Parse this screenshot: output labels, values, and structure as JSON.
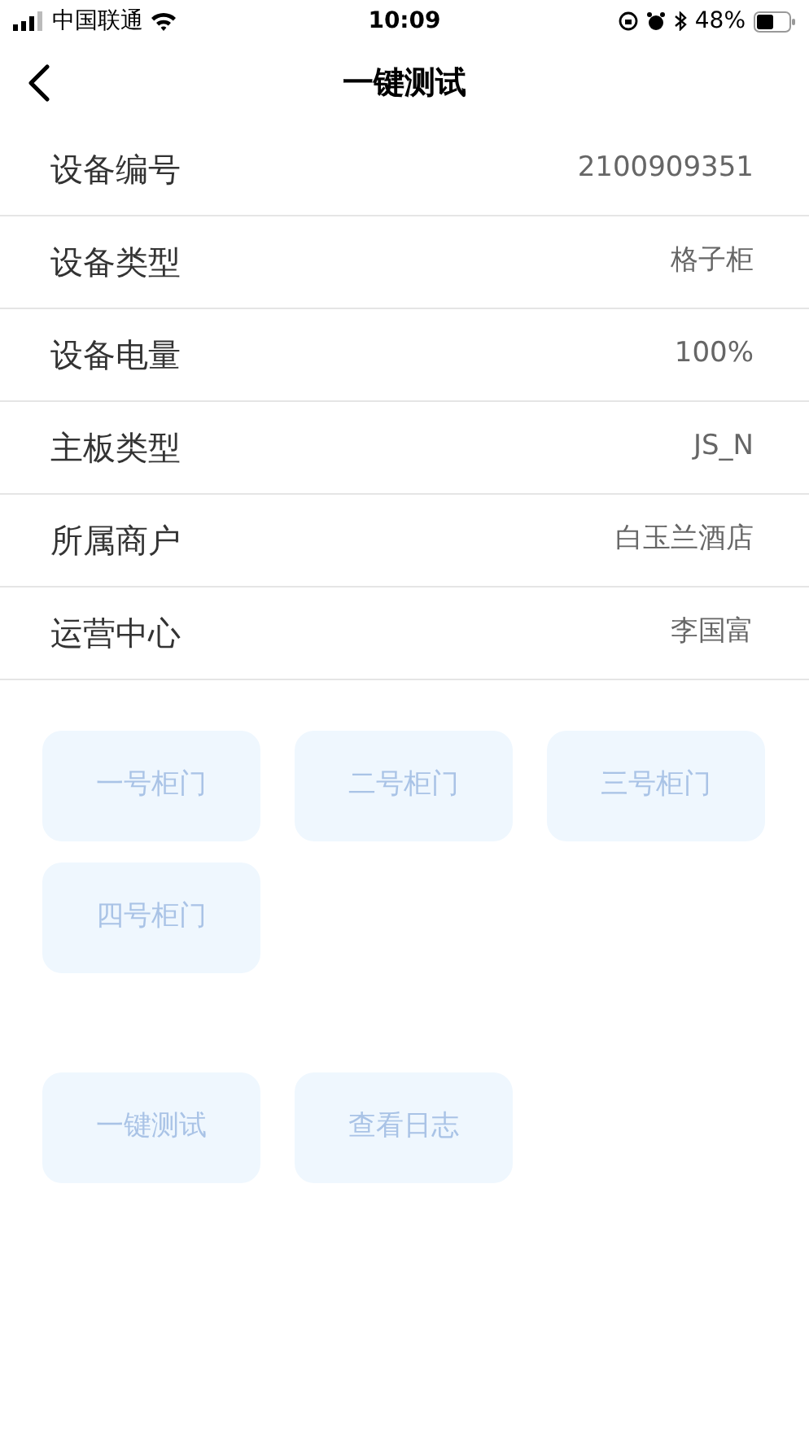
{
  "status_bar": {
    "carrier": "中国联通",
    "time": "10:09",
    "battery": "48%"
  },
  "nav": {
    "title": "一键测试"
  },
  "info_rows": [
    {
      "label": "设备编号",
      "value": "2100909351"
    },
    {
      "label": "设备类型",
      "value": "格子柜"
    },
    {
      "label": "设备电量",
      "value": "100%"
    },
    {
      "label": "主板类型",
      "value": "JS_N"
    },
    {
      "label": "所属商户",
      "value": "白玉兰酒店"
    },
    {
      "label": "运营中心",
      "value": "李国富"
    }
  ],
  "door_buttons": [
    "一号柜门",
    "二号柜门",
    "三号柜门",
    "四号柜门"
  ],
  "action_buttons": [
    "一键测试",
    "查看日志"
  ]
}
